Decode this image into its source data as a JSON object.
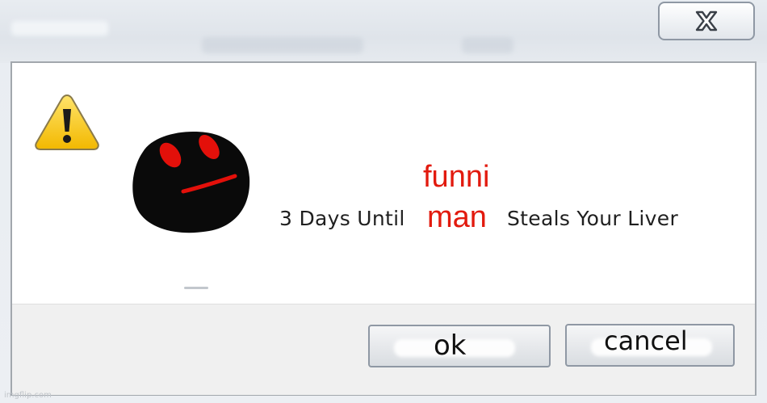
{
  "dialog": {
    "close_icon": "close-x-icon",
    "warning_icon": "warning-triangle-icon",
    "face_image": "black-ball-face",
    "message": {
      "prefix": "3 Days Until",
      "red_word_top": "funni",
      "red_word_bottom": "man",
      "suffix": "Steals Your Liver"
    },
    "buttons": {
      "ok_label": "ok",
      "cancel_label": "cancel"
    }
  },
  "watermark": "imgflip.com",
  "colors": {
    "accent_red": "#e21a0e",
    "warning_yellow": "#f5c400",
    "face_black": "#0a0a0a"
  }
}
